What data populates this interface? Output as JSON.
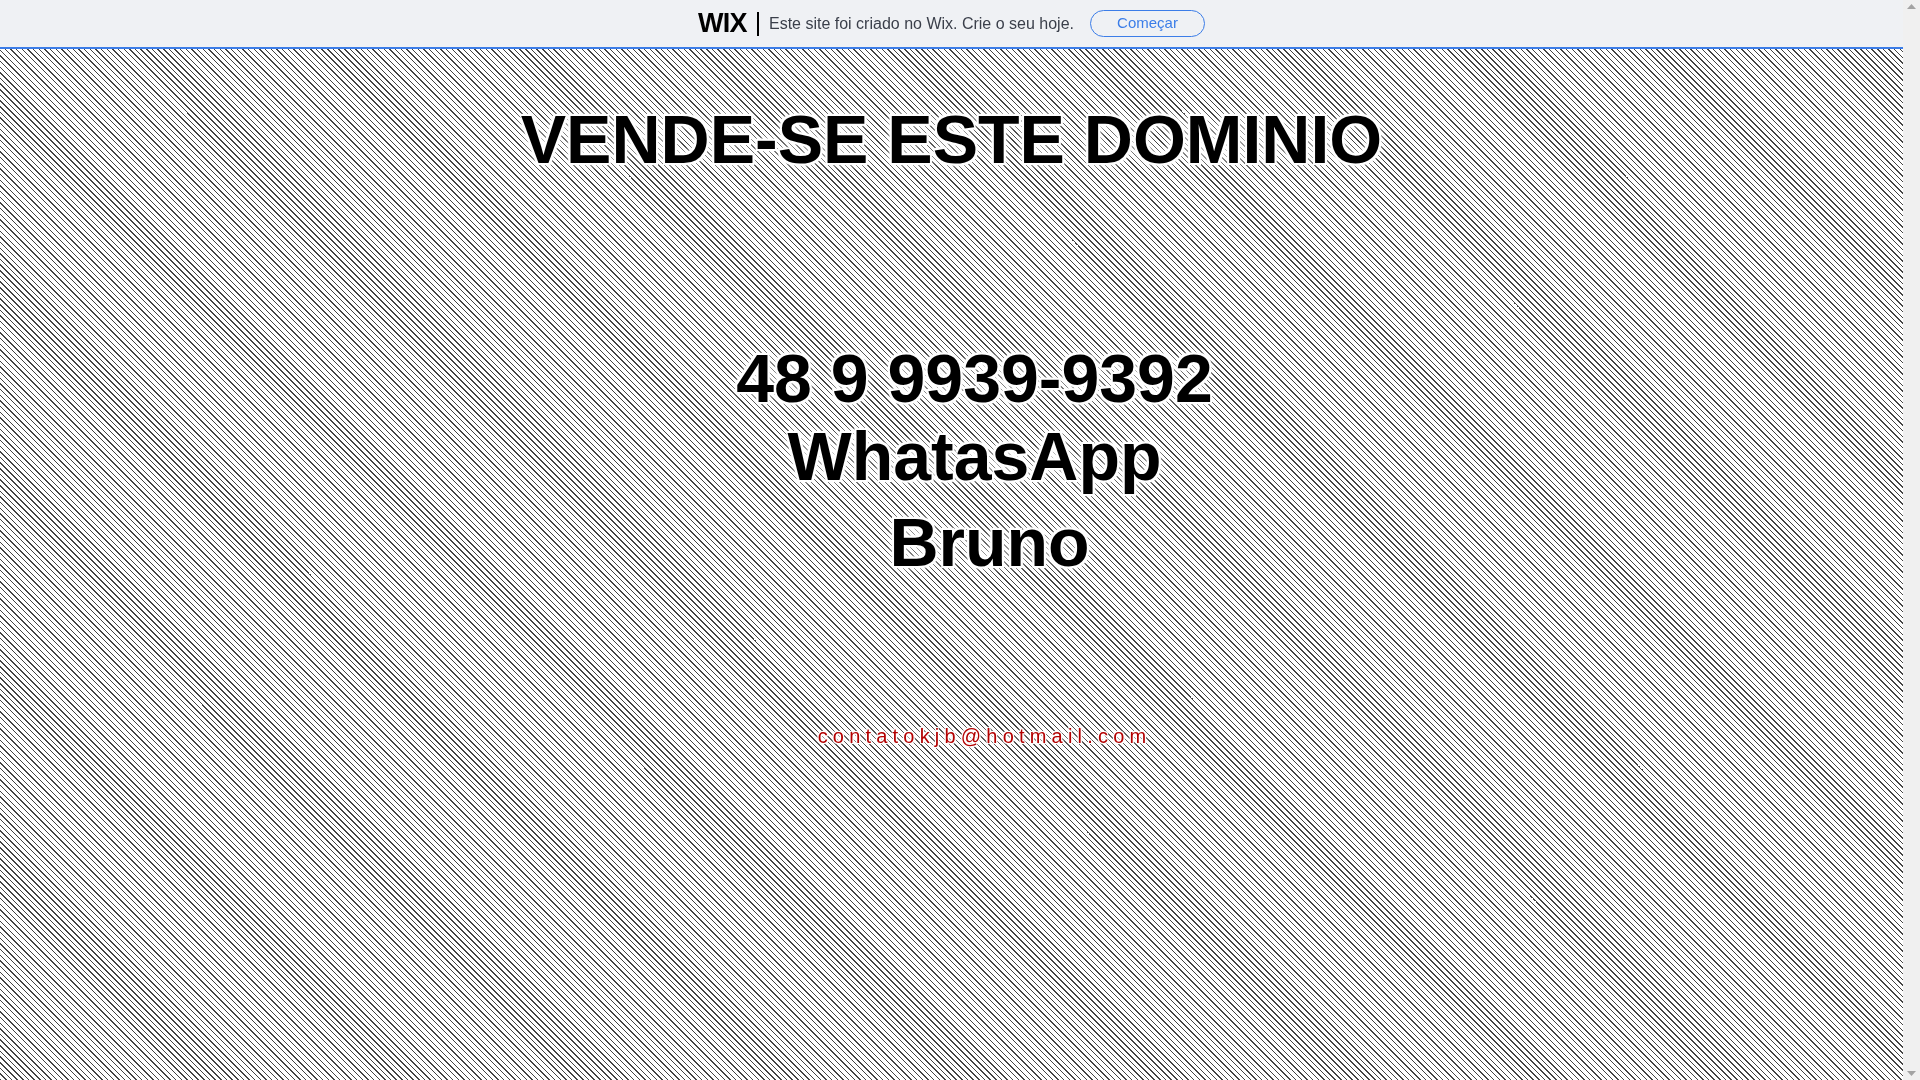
{
  "banner": {
    "logo": "WIX",
    "message": "Este site foi criado no Wix. Crie o seu hoje.",
    "button": "Começar"
  },
  "headline": "VENDE-SE ESTE DOMINIO",
  "contact_lines": [
    "48 9 9939-9392",
    "WhatasApp",
    "Bruno"
  ],
  "email": "contatokjb@hotmail.com"
}
